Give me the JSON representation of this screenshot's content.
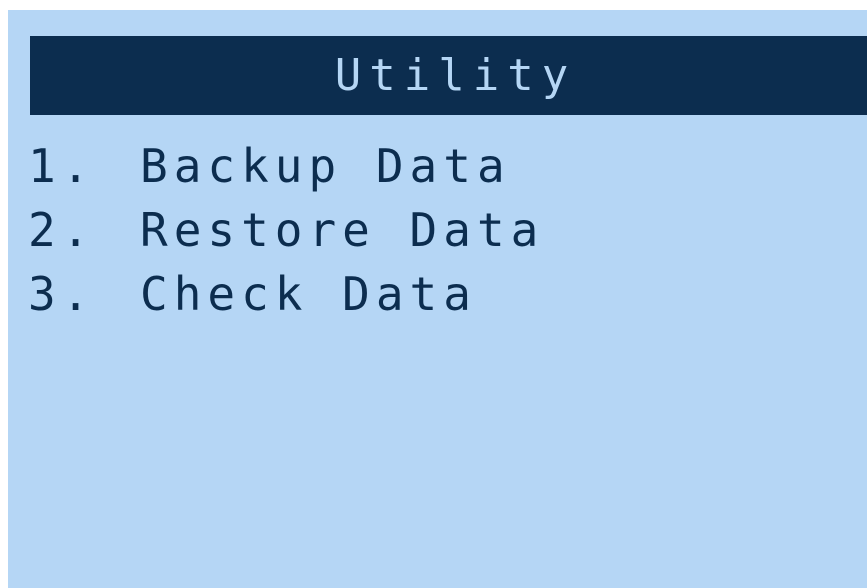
{
  "screen": {
    "title": "Utility",
    "menu": [
      {
        "number": "1.",
        "label": "Backup Data"
      },
      {
        "number": "2.",
        "label": "Restore Data"
      },
      {
        "number": "3.",
        "label": "Check Data"
      }
    ]
  },
  "colors": {
    "background": "#b5d6f5",
    "title_bar": "#0c2d4f",
    "text": "#0c2d4f"
  }
}
